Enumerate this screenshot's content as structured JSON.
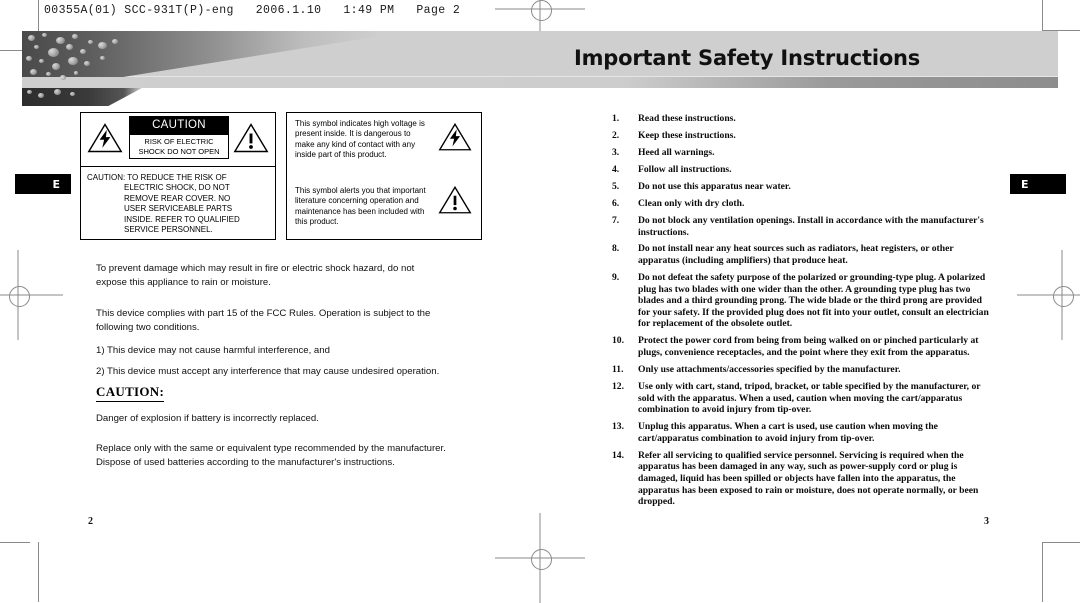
{
  "slug": "00355A(01) SCC-931T(P)-eng   2006.1.10   1:49 PM   Page 2",
  "banner": {
    "title": "Important Safety Instructions"
  },
  "tabs": {
    "left_label": "E",
    "right_label": "E"
  },
  "caution_box": {
    "plate_header": "CAUTION",
    "plate_line1": "RISK OF ELECTRIC",
    "plate_line2": "SHOCK DO NOT OPEN",
    "body_line1": "CAUTION: TO REDUCE THE RISK OF",
    "body_line2": "ELECTRIC SHOCK, DO NOT",
    "body_line3": "REMOVE REAR COVER. NO",
    "body_line4": "USER SERVICEABLE PARTS",
    "body_line5": "INSIDE. REFER TO QUALIFIED",
    "body_line6": "SERVICE PERSONNEL."
  },
  "symbol_box": {
    "bolt_text": "This symbol indicates high voltage is present inside. It is dangerous to make any kind of contact with any inside part of this product.",
    "bang_text": "This symbol alerts you that important literature concerning operation and maintenance has been included with this product."
  },
  "left_column": {
    "intro": "To prevent damage which may result in fire or electric shock hazard, do not expose this appliance to rain or moisture.",
    "fcc_main": "This device complies with part 15 of the FCC Rules. Operation is subject to the following two conditions.",
    "fcc_cond1": "1) This device may not cause harmful interference, and",
    "fcc_cond2": "2) This device must accept any interference that may cause undesired operation.",
    "caution_heading": "CAUTION:",
    "battery_line1": "Danger of explosion if battery is incorrectly replaced.",
    "battery_line2": "Replace only with the same or equivalent type recommended by the manufacturer. Dispose of used batteries according to the manufacturer's instructions."
  },
  "safety_instructions": [
    {
      "num": "1.",
      "text": "Read these instructions."
    },
    {
      "num": "2.",
      "text": "Keep these instructions."
    },
    {
      "num": "3.",
      "text": "Heed all warnings."
    },
    {
      "num": "4.",
      "text": "Follow all instructions."
    },
    {
      "num": "5.",
      "text": "Do not use this apparatus near water."
    },
    {
      "num": "6.",
      "text": "Clean only with dry cloth."
    },
    {
      "num": "7.",
      "text": "Do not block any ventilation openings. Install in accordance with the manufacturer's instructions."
    },
    {
      "num": "8.",
      "text": "Do not install near any heat sources such as radiators, heat registers, or other apparatus (including amplifiers) that produce heat."
    },
    {
      "num": "9.",
      "text": "Do not defeat the safety purpose of the polarized or grounding-type plug. A polarized plug has two blades with one wider than the other. A grounding type plug has two blades and a third grounding prong. The wide blade or the third prong are provided for your safety. If the provided plug does not fit into your outlet, consult an electrician for replacement of the obsolete outlet."
    },
    {
      "num": "10.",
      "text": "Protect the power cord from being from being walked on or pinched particularly at plugs, convenience receptacles, and the point where they exit from the apparatus."
    },
    {
      "num": "11.",
      "text": "Only use attachments/accessories specified by the manufacturer."
    },
    {
      "num": "12.",
      "text": "Use only with cart, stand, tripod, bracket, or table specified by the manufacturer, or sold with the apparatus. When a used, caution when moving the cart/apparatus combination to avoid injury from tip-over."
    },
    {
      "num": "13.",
      "text": "Unplug this apparatus. When a cart is used, use caution when moving the cart/apparatus combination to avoid injury from tip-over."
    },
    {
      "num": "14.",
      "text": "Refer all servicing to qualified service personnel. Servicing is required when the apparatus has been damaged in any way, such as power-supply cord or plug is damaged, liquid has been spilled or objects have fallen into the apparatus, the apparatus has been exposed to rain or moisture, does not operate normally, or been dropped."
    }
  ],
  "page_numbers": {
    "left": "2",
    "right": "3"
  },
  "colors": {
    "banner_light": "#cfcfcf",
    "banner_dark": "#4a4a4a",
    "tab_bg": "#000000",
    "mark": "#8a8a8a"
  }
}
